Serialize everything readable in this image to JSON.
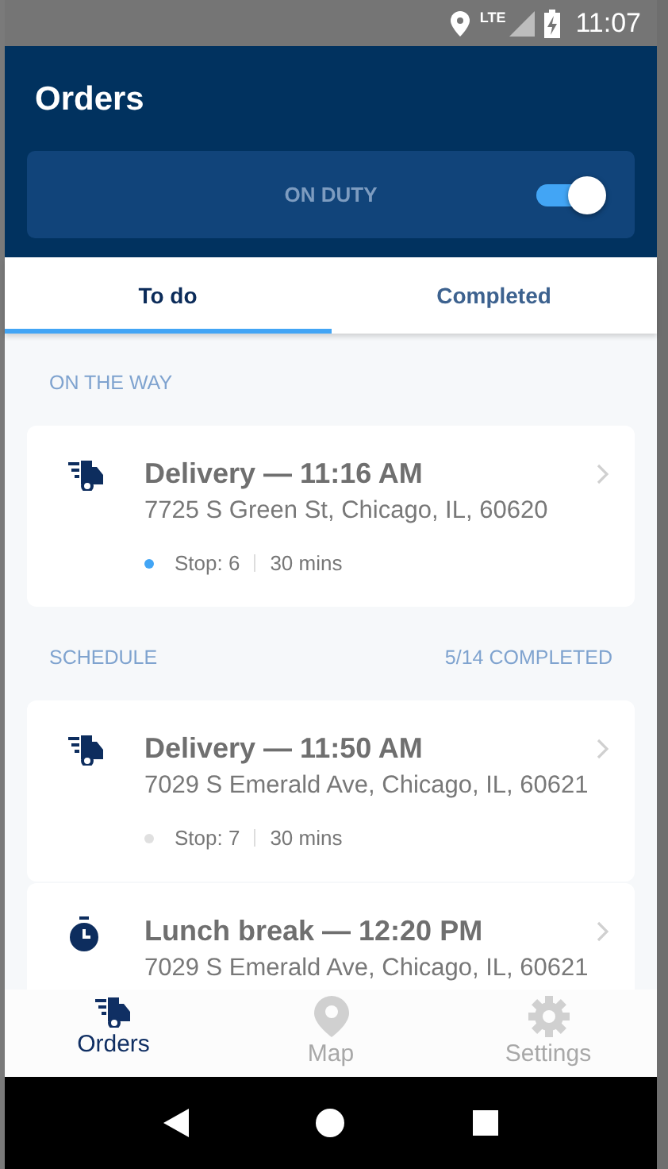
{
  "status_bar": {
    "network": "LTE",
    "time": "11:07"
  },
  "header": {
    "title": "Orders",
    "duty": {
      "label": "ON DUTY",
      "on": true
    }
  },
  "tabs": [
    {
      "label": "To do",
      "selected": true
    },
    {
      "label": "Completed",
      "selected": false
    }
  ],
  "sections": [
    {
      "title": "ON THE WAY",
      "orders": [
        {
          "kind": "delivery",
          "title": "Delivery — 11:16 AM",
          "address": "7725 S Green St, Chicago, IL, 60620",
          "stop": "Stop: 6",
          "duration": "30 mins",
          "color": "#42a5f5"
        }
      ]
    },
    {
      "title": "SCHEDULE",
      "progress": "5/14 COMPLETED",
      "orders": [
        {
          "kind": "delivery",
          "title": "Delivery — 11:50 AM",
          "address": "7029 S Emerald Ave, Chicago, IL, 60621",
          "stop": "Stop: 7",
          "duration": "30 mins",
          "color": "#e0e0e0"
        },
        {
          "kind": "break",
          "title": "Lunch break — 12:20 PM",
          "address": "7029 S Emerald Ave, Chicago, IL, 60621"
        }
      ]
    }
  ],
  "bottom_nav": [
    {
      "kind": "orders",
      "label": "Orders",
      "selected": true
    },
    {
      "kind": "map",
      "label": "Map",
      "selected": false
    },
    {
      "kind": "settings",
      "label": "Settings",
      "selected": false
    }
  ]
}
